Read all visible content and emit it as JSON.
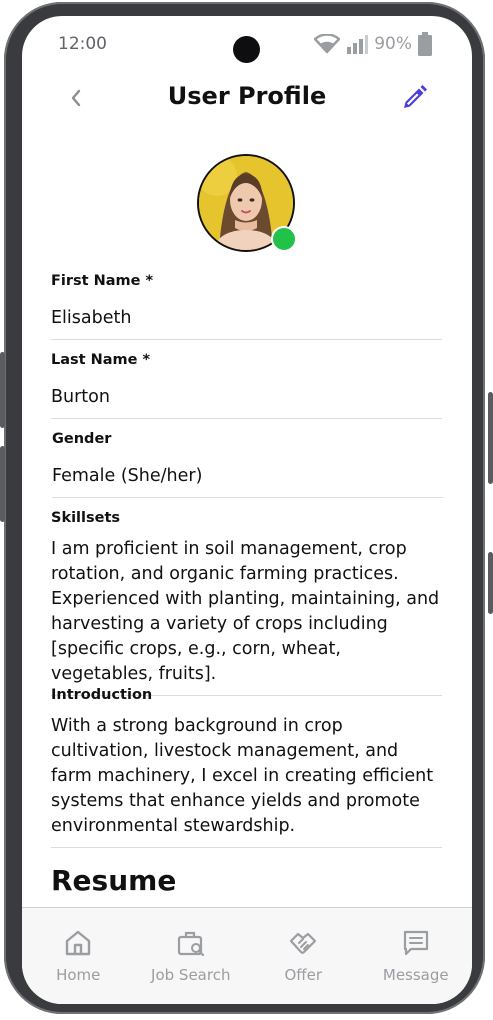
{
  "status": {
    "time": "12:00",
    "battery": "90%"
  },
  "header": {
    "title": "User Profile"
  },
  "profile": {
    "fields": [
      {
        "label": "First Name *",
        "value": "Elisabeth"
      },
      {
        "label": "Last Name *",
        "value": "Burton"
      },
      {
        "label": "Gender",
        "value": "Female (She/her)"
      },
      {
        "label": "Skillsets",
        "value": "I am proficient in soil management, crop rotation, and organic farming practices. Experienced with planting, maintaining, and harvesting a variety of crops including [specific crops, e.g., corn, wheat, vegetables, fruits]."
      },
      {
        "label": "Introduction",
        "value": "With a strong background in crop cultivation, livestock management, and farm machinery, I excel in creating efficient systems that enhance yields and promote environmental stewardship."
      }
    ],
    "resume_heading": "Resume",
    "online": true
  },
  "tabs": [
    {
      "label": "Home",
      "icon": "home-icon"
    },
    {
      "label": "Job Search",
      "icon": "job-search-icon"
    },
    {
      "label": "Offer",
      "icon": "handshake-icon"
    },
    {
      "label": "Message",
      "icon": "message-icon"
    }
  ],
  "colors": {
    "accent": "#4b3fd6",
    "online": "#22c24a",
    "muted": "#9a9da1"
  }
}
